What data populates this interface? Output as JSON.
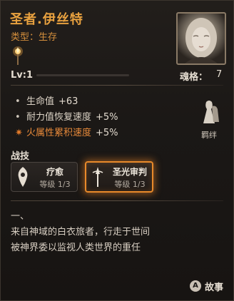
{
  "character": {
    "name": "圣者.伊丝特",
    "type_line": "类型：生存",
    "level": "Lv:1",
    "level_progress": 0.0,
    "soul_label": "魂格：",
    "soul_value": "7"
  },
  "stats": [
    {
      "label": "生命值",
      "value": "+63",
      "bullet": "•",
      "icon": "dot",
      "element": "normal"
    },
    {
      "label": "耐力值恢复速度",
      "value": "+5%",
      "bullet": "•",
      "icon": "dot",
      "element": "normal"
    },
    {
      "label": "火属性累积速度",
      "value": "+5%",
      "bullet": "✷",
      "icon": "fire-burst",
      "element": "fire"
    }
  ],
  "bond": {
    "label": "羁绊",
    "icon": "bond-figure"
  },
  "skills_title": "战技",
  "skills": [
    {
      "name": "疗愈",
      "level": "等级 1/3",
      "icon": "heal-skill",
      "selected": false
    },
    {
      "name": "圣光审判",
      "level": "等级 1/3",
      "icon": "holy-judgement-skill",
      "selected": true
    }
  ],
  "description": {
    "line1": "一、",
    "line2": "来自神域的白衣旅者，行走于世间",
    "line3": "被神界委以监视人类世界的重任"
  },
  "story": {
    "label": "故事",
    "key_glyph": "A",
    "icon": "button-a-icon"
  },
  "colors": {
    "title": "#e8a13f",
    "type": "#d58f3d",
    "fire": "#e88a3a",
    "highlight_border": "#e98a2a",
    "background": "#1a1715"
  }
}
